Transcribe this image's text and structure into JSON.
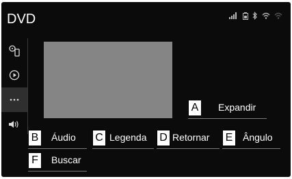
{
  "header": {
    "title": "DVD"
  },
  "status_icons": [
    "signal-icon",
    "battery-icon",
    "bluetooth-icon",
    "wifi-icon"
  ],
  "sidebar": {
    "items": [
      {
        "name": "sidebar-item-source",
        "icon": "disc-phone-icon"
      },
      {
        "name": "sidebar-item-play",
        "icon": "play-circle-icon"
      },
      {
        "name": "sidebar-item-more",
        "icon": "more-icon",
        "active": true
      },
      {
        "name": "sidebar-item-sound",
        "icon": "speaker-icon"
      }
    ]
  },
  "buttons": {
    "expand": {
      "key": "A",
      "label": "Expandir"
    },
    "audio": {
      "key": "B",
      "label": "Áudio"
    },
    "subtitle": {
      "key": "C",
      "label": "Legenda"
    },
    "back": {
      "key": "D",
      "label": "Retornar"
    },
    "angle": {
      "key": "E",
      "label": "Ângulo"
    },
    "search": {
      "key": "F",
      "label": "Buscar"
    }
  }
}
